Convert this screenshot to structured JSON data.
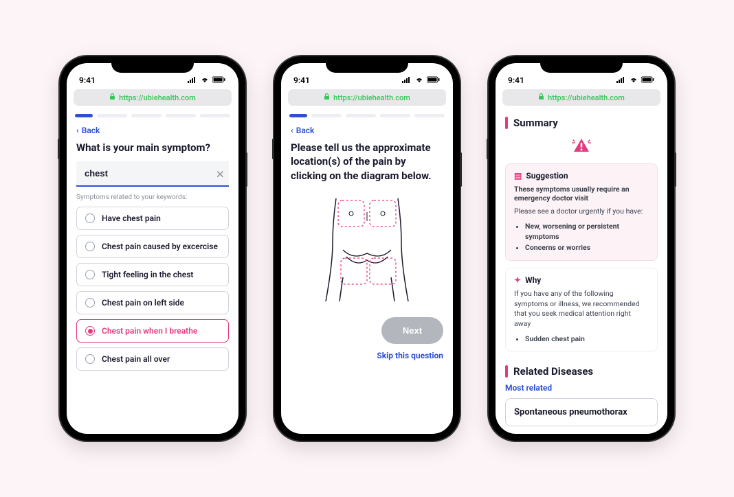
{
  "statusbar": {
    "time": "9:41"
  },
  "addressbar": {
    "url": "https://ubiehealth.com"
  },
  "phone1": {
    "back": "Back",
    "title": "What is your main symptom?",
    "search_value": "chest",
    "hint": "Symptoms related to your keywords:",
    "options": [
      {
        "label": "Have chest pain",
        "selected": false
      },
      {
        "label": "Chest pain caused by excercise",
        "selected": false
      },
      {
        "label": "Tight feeling in the chest",
        "selected": false
      },
      {
        "label": "Chest pain on left side",
        "selected": false
      },
      {
        "label": "Chest pain when I breathe",
        "selected": true
      },
      {
        "label": "Chest pain all over",
        "selected": false
      }
    ]
  },
  "phone2": {
    "back": "Back",
    "title": "Please tell us the approximate location(s) of the pain by clicking on the diagram below.",
    "next": "Next",
    "skip": "Skip this question"
  },
  "phone3": {
    "summary": "Summary",
    "suggestion": {
      "title": "Suggestion",
      "headline": "These symptoms usually require an emergency doctor visit",
      "subtext": "Please see a doctor urgently if you have:",
      "bullets": [
        "New, worsening or persistent symptoms",
        "Concerns or worries"
      ]
    },
    "why": {
      "title": "Why",
      "text": "If you have any of the following symptoms or illness, we recommended that you seek medical attention right away",
      "bullets": [
        "Sudden chest pain"
      ]
    },
    "related": "Related Diseases",
    "most_related": "Most related",
    "disease": "Spontaneous pneumothorax"
  }
}
